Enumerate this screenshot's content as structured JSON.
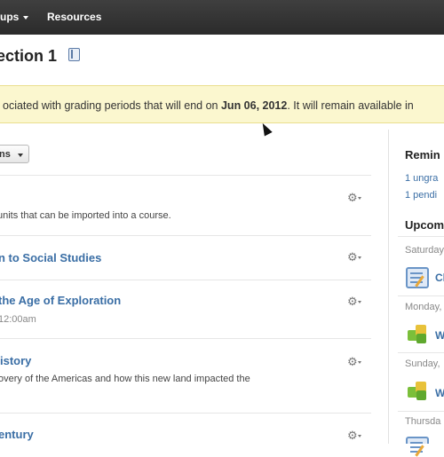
{
  "topbar": {
    "groups_label": "ups",
    "resources_label": "Resources"
  },
  "page": {
    "title": "ection 1",
    "subline": "l"
  },
  "banner": {
    "prefix": "ociated with grading periods that will end on ",
    "date": "Jun 06, 2012",
    "suffix": ". It will remain available in"
  },
  "options_button": {
    "label": "ns"
  },
  "items": [
    {
      "description": "units that can be imported into a course."
    },
    {
      "title": "n to Social Studies"
    },
    {
      "title": "the Age of Exploration",
      "meta": "12:00am"
    },
    {
      "title": "istory",
      "description": "overy of the Americas and how this new land impacted the"
    },
    {
      "title": "entury"
    }
  ],
  "sidebar": {
    "reminders_heading": "Remin",
    "reminders": [
      "1 ungra",
      "1 pendi"
    ],
    "upcoming_heading": "Upcom",
    "days": [
      "Saturday",
      "Monday,",
      "Sunday,",
      "Thursda"
    ],
    "upcoming_items": [
      "Cl",
      "W",
      "W"
    ]
  },
  "icons": {
    "gear": "gear-icon",
    "book": "book-icon",
    "calendar": "calendar-icon",
    "puzzle": "puzzle-icon",
    "cursor": "mouse-cursor-icon"
  }
}
